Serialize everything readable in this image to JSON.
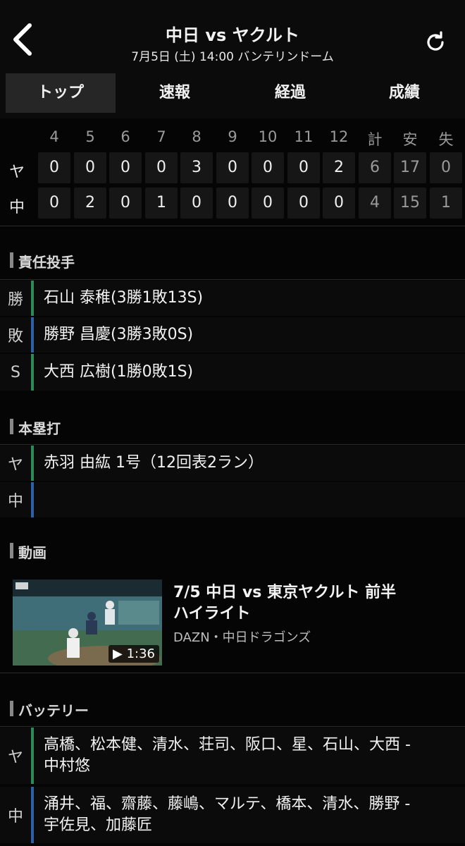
{
  "header": {
    "title": "中日 vs ヤクルト",
    "subtitle": "7月5日 (土) 14:00 バンテリンドーム",
    "back_icon": "chevron-left-icon",
    "refresh_icon": "refresh-icon"
  },
  "tabs": [
    {
      "label": "トップ",
      "active": true
    },
    {
      "label": "速報",
      "active": false
    },
    {
      "label": "経過",
      "active": false
    },
    {
      "label": "成績",
      "active": false
    }
  ],
  "scoreboard": {
    "headers": [
      "4",
      "5",
      "6",
      "7",
      "8",
      "9",
      "10",
      "11",
      "12",
      "計",
      "安",
      "失"
    ],
    "teams": [
      {
        "label": "ヤ",
        "scores": [
          "0",
          "0",
          "0",
          "0",
          "3",
          "0",
          "0",
          "0",
          "2"
        ],
        "stats": [
          "6",
          "17",
          "0"
        ]
      },
      {
        "label": "中",
        "scores": [
          "0",
          "2",
          "0",
          "1",
          "0",
          "0",
          "0",
          "0",
          "0"
        ],
        "stats": [
          "4",
          "15",
          "1"
        ]
      }
    ]
  },
  "pitchers": {
    "title": "責任投手",
    "rows": [
      {
        "label": "勝",
        "text": "石山 泰稚(3勝1敗13S)",
        "color": "#2e8b57"
      },
      {
        "label": "敗",
        "text": "勝野 昌慶(3勝3敗0S)",
        "color": "#2f5fa7"
      },
      {
        "label": "S",
        "text": "大西 広樹(1勝0敗1S)",
        "color": "#2e8b57"
      }
    ]
  },
  "homeruns": {
    "title": "本塁打",
    "rows": [
      {
        "label": "ヤ",
        "text": "赤羽 由紘 1号（12回表2ラン）",
        "color": "#2e8b57"
      },
      {
        "label": "中",
        "text": "",
        "color": "#2f5fa7"
      }
    ]
  },
  "video_section": {
    "title": "動画",
    "video": {
      "title_line1": "7/5 中日 vs 東京ヤクルト  前半",
      "title_line2": "ハイライト",
      "source": "DAZN・中日ドラゴンズ",
      "duration": "▶ 1:36"
    }
  },
  "battery": {
    "title": "バッテリー",
    "rows": [
      {
        "label": "ヤ",
        "line1": "高橋、松本健、清水、荘司、阪口、星、石山、大西 -",
        "line2": "中村悠",
        "color": "#2e8b57"
      },
      {
        "label": "中",
        "line1": "涌井、福、齋藤、藤嶋、マルテ、橋本、清水、勝野 -",
        "line2": "宇佐見、加藤匠",
        "color": "#2f5fa7"
      }
    ]
  },
  "colors": {
    "background": "#050505",
    "panel": "#0b0b0b",
    "cell": "#161616",
    "swallows_green": "#2e8b57",
    "dragons_blue": "#2f5fa7"
  }
}
